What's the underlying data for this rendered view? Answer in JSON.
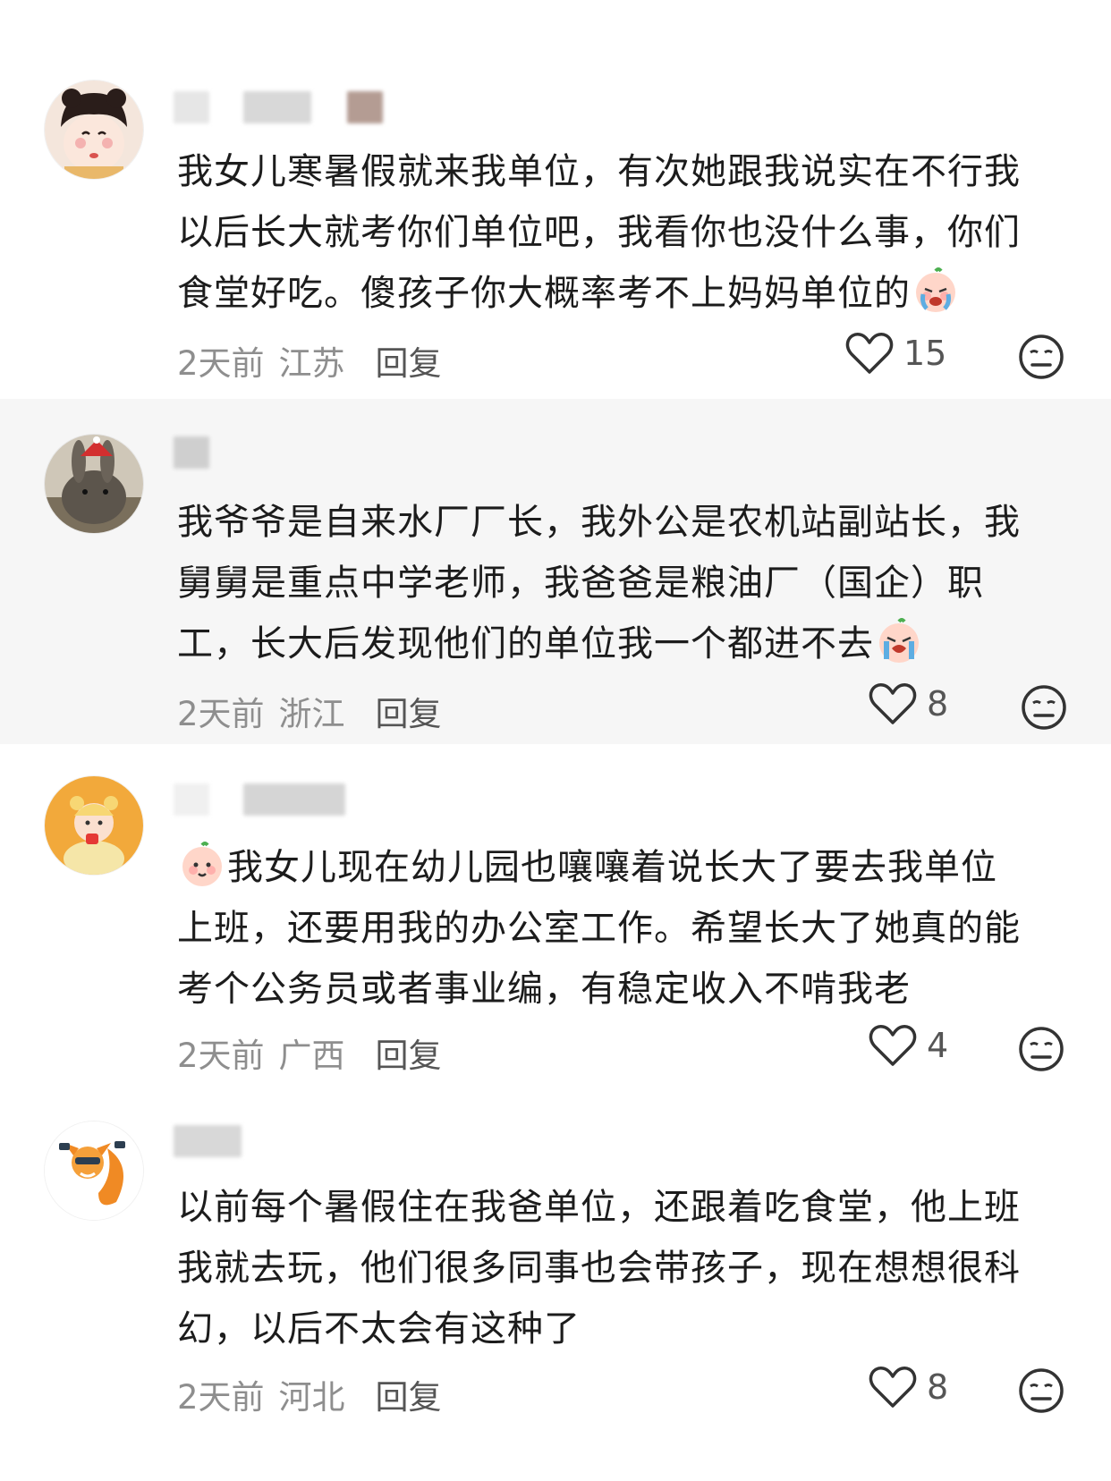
{
  "reply_label": "回复",
  "comments": [
    {
      "text_lines": [
        "我女儿寒暑假就来我单位，有次她跟我说实在不行我",
        "以后长大就考你们单位吧，我看你也没什么事，你们",
        "食堂好吃。傻孩子你大概率考不上妈妈单位的"
      ],
      "emoji": "crying-face",
      "time": "2天前",
      "location": "江苏",
      "likes": "15"
    },
    {
      "text_lines": [
        "我爷爷是自来水厂厂长，我外公是农机站副站长，我",
        "舅舅是重点中学老师，我爸爸是粮油厂（国企）职",
        "工，长大后发现他们的单位我一个都进不去"
      ],
      "emoji": "sobbing-face",
      "time": "2天前",
      "location": "浙江",
      "likes": "8"
    },
    {
      "text_lines": [
        "我女儿现在幼儿园也嚷嚷着说长大了要去我单位",
        "上班，还要用我的办公室工作。希望长大了她真的能",
        "考个公务员或者事业编，有稳定收入不啃我老"
      ],
      "emoji": "peach-face",
      "time": "2天前",
      "location": "广西",
      "likes": "4"
    },
    {
      "text_lines": [
        "以前每个暑假住在我爸单位，还跟着吃食堂，他上班",
        "我就去玩，他们很多同事也会带孩子，现在想想很科",
        "幻，以后不太会有这种了"
      ],
      "time": "2天前",
      "location": "河北",
      "likes": "8"
    }
  ]
}
